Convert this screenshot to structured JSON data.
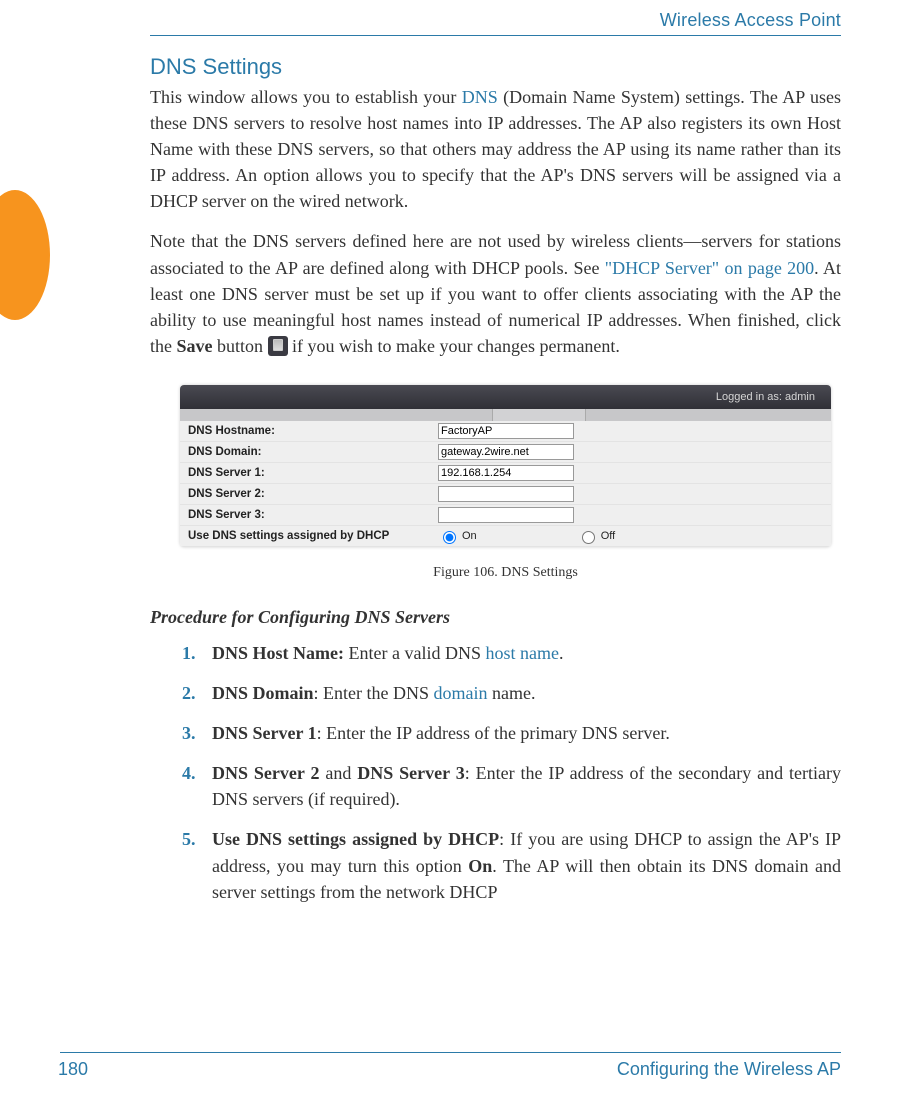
{
  "running_header": "Wireless Access Point",
  "tab_marker_color": "#f7941e",
  "section_title": "DNS Settings",
  "para1": {
    "text_prefix": "This window allows you to establish your ",
    "link1": "DNS",
    "text_suffix": " (Domain Name System) settings. The AP uses these DNS servers to resolve host names into IP addresses. The AP also registers its own Host Name with these DNS servers, so that others may address the AP using its name rather than its IP address. An option allows you to specify that the AP's DNS servers will be assigned via a DHCP server on the wired network."
  },
  "para2": {
    "t1": "Note that the DNS servers defined here are not used by wireless clients—servers for stations associated to the AP are defined along with DHCP pools. See ",
    "link1": "\"DHCP Server\" on page 200",
    "t2": ". At least one DNS server must be set up if you want to offer clients associating with the AP the ability to use meaningful host names instead of numerical IP addresses. When finished, click the ",
    "bold1": "Save",
    "t3": " button ",
    "t4": " if you wish to make your changes permanent."
  },
  "figure": {
    "topbar_text": "Logged in as: admin",
    "rows": [
      {
        "label": "DNS Hostname:",
        "value": "FactoryAP",
        "type": "text"
      },
      {
        "label": "DNS Domain:",
        "value": "gateway.2wire.net",
        "type": "text"
      },
      {
        "label": "DNS Server 1:",
        "value": "192.168.1.254",
        "type": "text"
      },
      {
        "label": "DNS Server 2:",
        "value": "",
        "type": "text"
      },
      {
        "label": "DNS Server 3:",
        "value": "",
        "type": "text"
      },
      {
        "label": "Use DNS settings assigned by DHCP",
        "type": "radio",
        "on": "On",
        "off": "Off",
        "selected": "on"
      }
    ],
    "caption": "Figure 106. DNS Settings"
  },
  "procedure": {
    "heading": "Procedure for Configuring DNS Servers",
    "items": [
      {
        "bold": "DNS Host Name:",
        "t1": " Enter a valid DNS ",
        "link": "host name",
        "t2": "."
      },
      {
        "bold": "DNS Domain",
        "t1": ": Enter the DNS ",
        "link": "domain",
        "t2": " name."
      },
      {
        "bold": "DNS Server 1",
        "t1": ": Enter the IP address of the primary DNS server."
      },
      {
        "bold": "DNS Server 2",
        "mid": " and ",
        "bold2": "DNS Server 3",
        "t1": ": Enter the IP address of the secondary and tertiary DNS servers (if required)."
      },
      {
        "bold": "Use DNS settings assigned by DHCP",
        "t1": ": If you are using DHCP to assign the AP's IP address, you may turn this option ",
        "bold2": "On",
        "t2": ". The AP will then obtain its DNS domain and server settings from the network DHCP"
      }
    ]
  },
  "footer": {
    "page_number": "180",
    "section": "Configuring the Wireless AP"
  }
}
